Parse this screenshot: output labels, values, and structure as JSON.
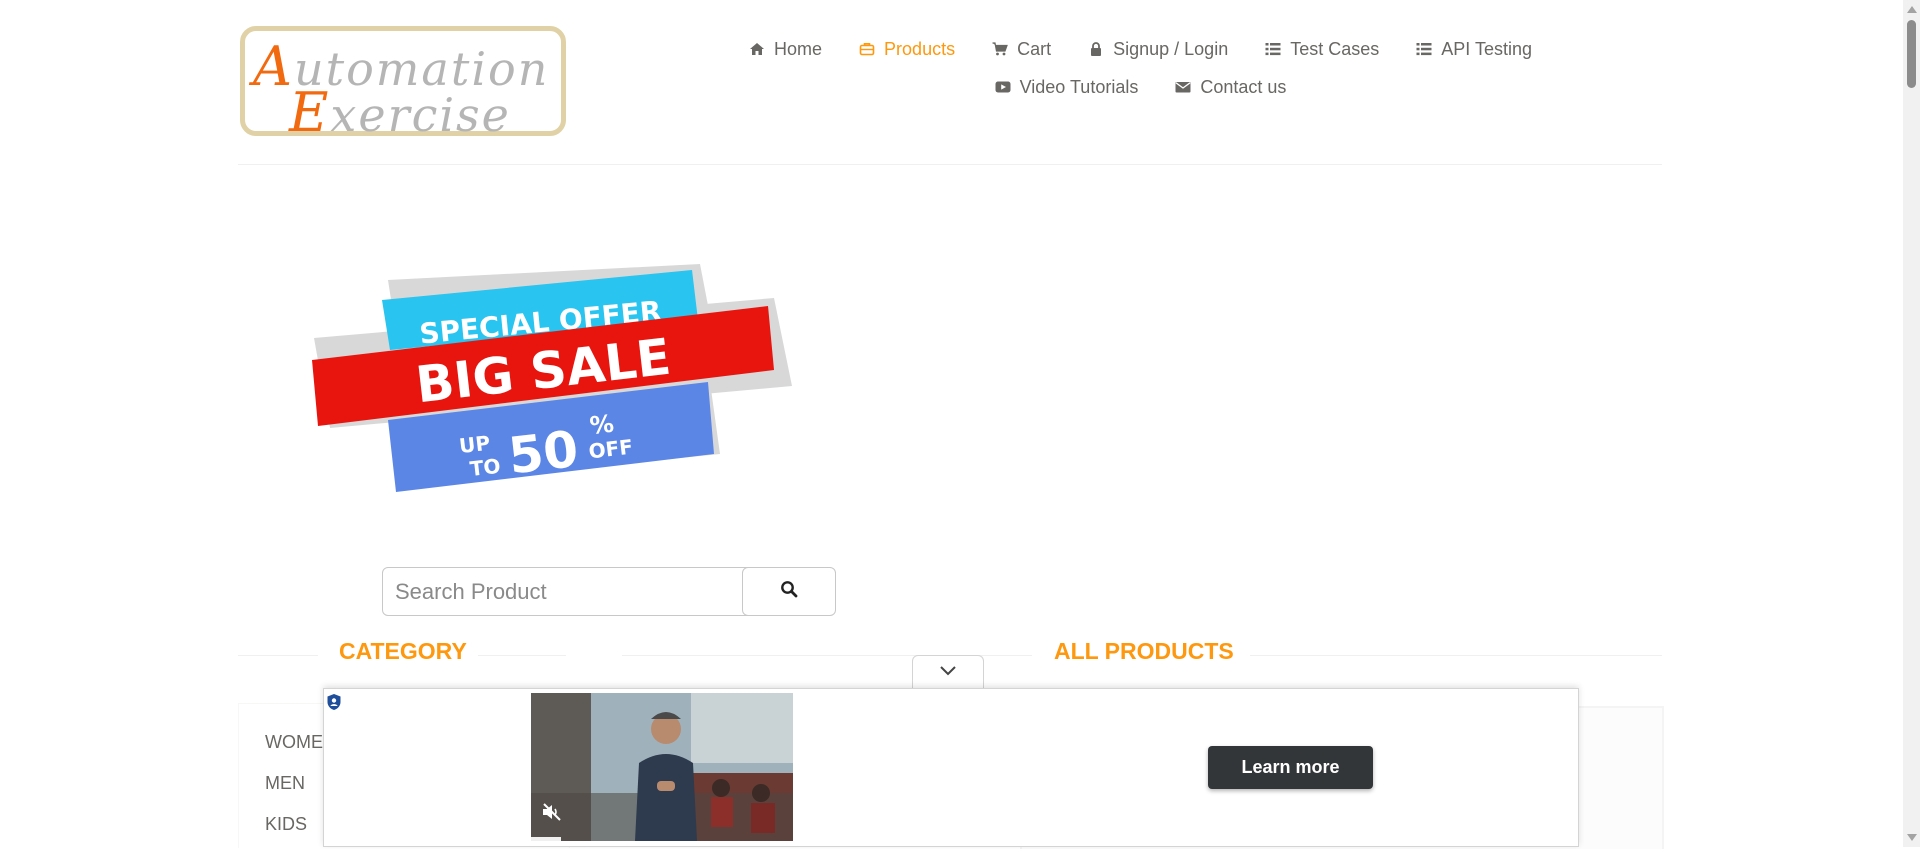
{
  "header": {
    "logo": {
      "line1_cap": "A",
      "line1_rest": "utomation",
      "line2_cap": "E",
      "line2_rest": "xercise"
    },
    "nav": [
      {
        "label": "Home",
        "icon": "home-icon",
        "active": false
      },
      {
        "label": "Products",
        "icon": "briefcase-icon",
        "active": true
      },
      {
        "label": "Cart",
        "icon": "cart-icon",
        "active": false
      },
      {
        "label": "Signup / Login",
        "icon": "lock-icon",
        "active": false
      },
      {
        "label": "Test Cases",
        "icon": "list-icon",
        "active": false
      },
      {
        "label": "API Testing",
        "icon": "list-icon",
        "active": false
      },
      {
        "label": "Video Tutorials",
        "icon": "youtube-icon",
        "active": false
      },
      {
        "label": "Contact us",
        "icon": "envelope-icon",
        "active": false
      }
    ]
  },
  "banner": {
    "line1": "SPECIAL OFFER",
    "line2": "BIG SALE",
    "up": "UP",
    "to": "TO",
    "percent_value": "50",
    "percent_sign": "%",
    "off": "OFF"
  },
  "search": {
    "placeholder": "Search Product",
    "icon": "search-icon"
  },
  "sections": {
    "category_title": "CATEGORY",
    "products_title": "ALL PRODUCTS"
  },
  "categories": [
    "WOMEN",
    "MEN",
    "KIDS"
  ],
  "ad": {
    "cta_label": "Learn more",
    "collapse_icon": "chevron-down-icon",
    "badge_icon": "shield-icon",
    "mute_icon": "muted-speaker-icon"
  },
  "colors": {
    "accent": "#fe980f",
    "text": "#696763",
    "banner_cyan": "#29c4ef",
    "banner_red": "#e8150f",
    "banner_blue": "#5b86e6",
    "ad_button": "#333639"
  }
}
